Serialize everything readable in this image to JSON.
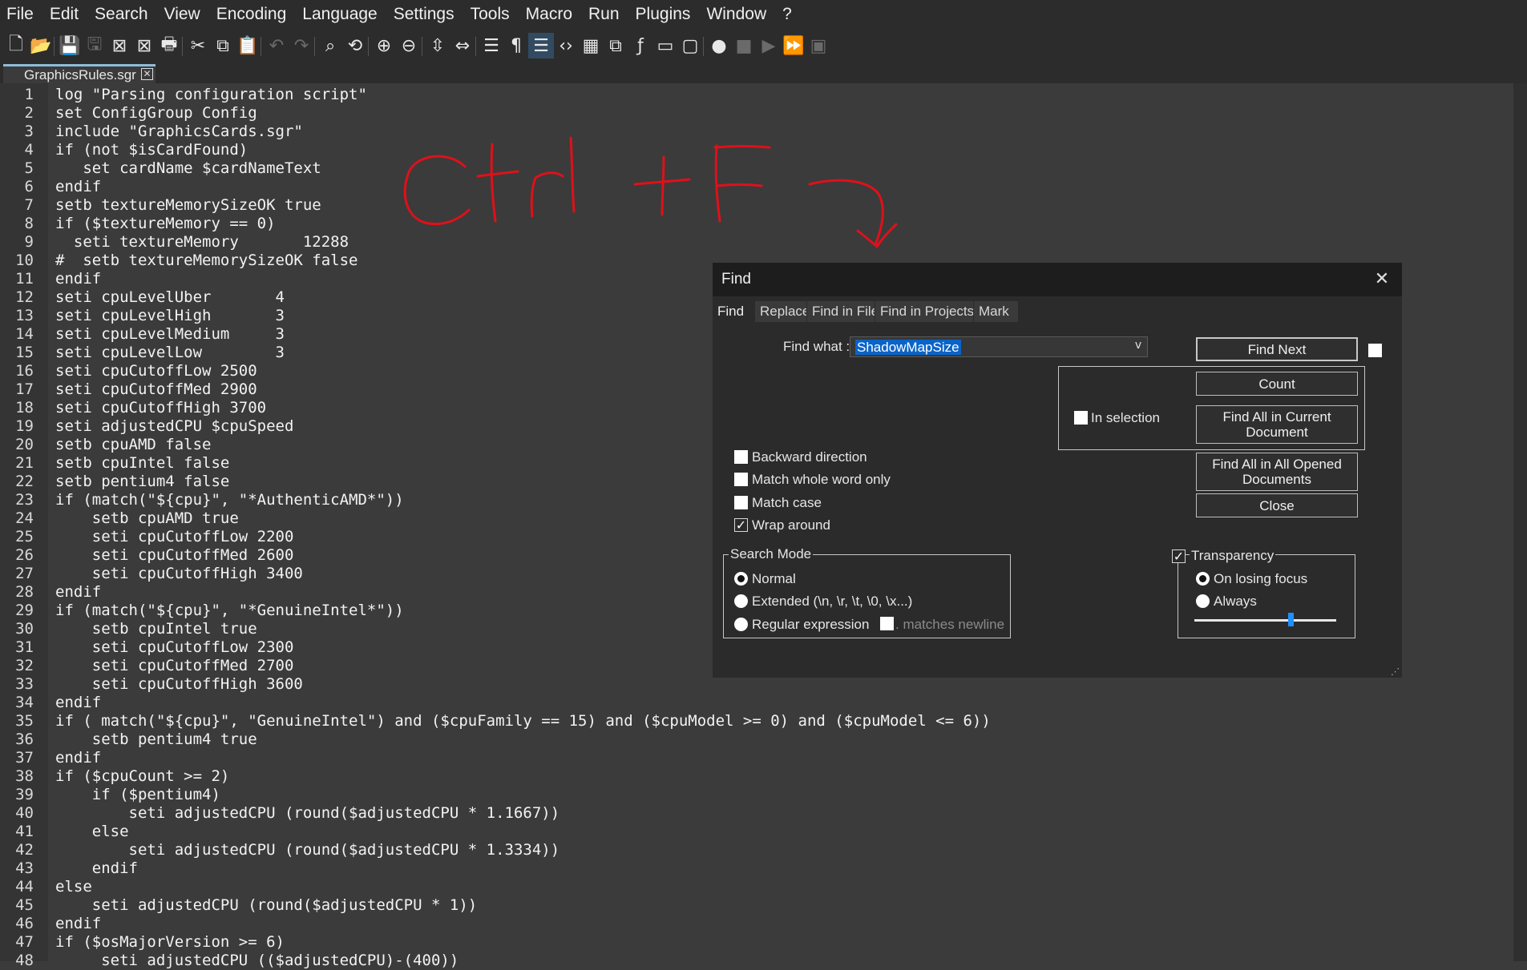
{
  "menu": [
    "File",
    "Edit",
    "Search",
    "View",
    "Encoding",
    "Language",
    "Settings",
    "Tools",
    "Macro",
    "Run",
    "Plugins",
    "Window",
    "?"
  ],
  "tab": {
    "filename": "GraphicsRules.sgr",
    "close_glyph": "✕"
  },
  "toolbar_icons": [
    "new-file-icon",
    "open-folder-icon",
    "save-icon",
    "save-all-icon",
    "close-icon",
    "close-all-icon",
    "print-icon",
    "cut-icon",
    "copy-icon",
    "paste-icon",
    "undo-icon",
    "redo-icon",
    "find-icon",
    "replace-icon",
    "zoom-in-icon",
    "zoom-out-icon",
    "sync-vertical-icon",
    "sync-horizontal-icon",
    "word-wrap-icon",
    "show-all-chars-icon",
    "indent-guide-icon",
    "xml-tags-icon",
    "document-map-icon",
    "document-list-icon",
    "function-list-icon",
    "monitor-icon",
    "folder-workspace-icon",
    "record-macro-icon",
    "stop-record-icon",
    "play-macro-icon",
    "run-macro-multiple-icon",
    "save-macro-icon"
  ],
  "lines": [
    {
      "n": "1",
      "t": "log \"Parsing configuration script\""
    },
    {
      "n": "2",
      "t": "set ConfigGroup Config"
    },
    {
      "n": "3",
      "t": "include \"GraphicsCards.sgr\""
    },
    {
      "n": "4",
      "t": "if (not $isCardFound)"
    },
    {
      "n": "5",
      "t": "   set cardName $cardNameText"
    },
    {
      "n": "6",
      "t": "endif"
    },
    {
      "n": "7",
      "t": "setb textureMemorySizeOK true"
    },
    {
      "n": "8",
      "t": "if ($textureMemory == 0)"
    },
    {
      "n": "9",
      "t": "  seti textureMemory       12288"
    },
    {
      "n": "10",
      "t": "#  setb textureMemorySizeOK false"
    },
    {
      "n": "11",
      "t": "endif"
    },
    {
      "n": "12",
      "t": "seti cpuLevelUber       4"
    },
    {
      "n": "13",
      "t": "seti cpuLevelHigh       3"
    },
    {
      "n": "14",
      "t": "seti cpuLevelMedium     3"
    },
    {
      "n": "15",
      "t": "seti cpuLevelLow        3"
    },
    {
      "n": "16",
      "t": "seti cpuCutoffLow 2500"
    },
    {
      "n": "17",
      "t": "seti cpuCutoffMed 2900"
    },
    {
      "n": "18",
      "t": "seti cpuCutoffHigh 3700"
    },
    {
      "n": "19",
      "t": "seti adjustedCPU $cpuSpeed"
    },
    {
      "n": "20",
      "t": "setb cpuAMD false"
    },
    {
      "n": "21",
      "t": "setb cpuIntel false"
    },
    {
      "n": "22",
      "t": "setb pentium4 false"
    },
    {
      "n": "23",
      "t": "if (match(\"${cpu}\", \"*AuthenticAMD*\"))"
    },
    {
      "n": "24",
      "t": "    setb cpuAMD true"
    },
    {
      "n": "25",
      "t": "    seti cpuCutoffLow 2200"
    },
    {
      "n": "26",
      "t": "    seti cpuCutoffMed 2600"
    },
    {
      "n": "27",
      "t": "    seti cpuCutoffHigh 3400"
    },
    {
      "n": "28",
      "t": "endif"
    },
    {
      "n": "29",
      "t": "if (match(\"${cpu}\", \"*GenuineIntel*\"))"
    },
    {
      "n": "30",
      "t": "    setb cpuIntel true"
    },
    {
      "n": "31",
      "t": "    seti cpuCutoffLow 2300"
    },
    {
      "n": "32",
      "t": "    seti cpuCutoffMed 2700"
    },
    {
      "n": "33",
      "t": "    seti cpuCutoffHigh 3600"
    },
    {
      "n": "34",
      "t": "endif"
    },
    {
      "n": "35",
      "t": "if ( match(\"${cpu}\", \"GenuineIntel\") and ($cpuFamily == 15) and ($cpuModel >= 0) and ($cpuModel <= 6))"
    },
    {
      "n": "36",
      "t": "    setb pentium4 true"
    },
    {
      "n": "37",
      "t": "endif"
    },
    {
      "n": "38",
      "t": "if ($cpuCount >= 2)"
    },
    {
      "n": "39",
      "t": "    if ($pentium4)"
    },
    {
      "n": "40",
      "t": "        seti adjustedCPU (round($adjustedCPU * 1.1667))"
    },
    {
      "n": "41",
      "t": "    else"
    },
    {
      "n": "42",
      "t": "        seti adjustedCPU (round($adjustedCPU * 1.3334))"
    },
    {
      "n": "43",
      "t": "    endif"
    },
    {
      "n": "44",
      "t": "else"
    },
    {
      "n": "45",
      "t": "    seti adjustedCPU (round($adjustedCPU * 1))"
    },
    {
      "n": "46",
      "t": "endif"
    },
    {
      "n": "47",
      "t": "if ($osMajorVersion >= 6)"
    },
    {
      "n": "48",
      "t": "     seti adjustedCPU (($adjustedCPU)-(400))"
    }
  ],
  "find": {
    "title": "Find",
    "close_glyph": "✕",
    "tabs": [
      "Find",
      "Replace",
      "Find in Files",
      "Find in Projects",
      "Mark"
    ],
    "find_what_label": "Find what :",
    "find_what_value": "ShadowMapSize",
    "combo_arrow": "v",
    "buttons": {
      "find_next": "Find Next",
      "count": "Count",
      "find_all_current": "Find All in Current Document",
      "find_all_opened": "Find All in All Opened Documents",
      "close": "Close"
    },
    "in_selection": "In selection",
    "options": {
      "backward": "Backward direction",
      "whole_word": "Match whole word only",
      "match_case": "Match case",
      "wrap_around": "Wrap around"
    },
    "search_mode": {
      "title": "Search Mode",
      "normal": "Normal",
      "extended": "Extended (\\n, \\r, \\t, \\0, \\x...)",
      "regex": "Regular expression",
      "matches_newline": ". matches newline",
      "selected": "normal"
    },
    "transparency": {
      "title": "Transparency",
      "on_losing_focus": "On losing focus",
      "always": "Always",
      "checked": true,
      "selected": "on_losing_focus",
      "level": 0.68
    }
  },
  "colors": {
    "annotation": "#e0101a",
    "accent": "#1e90ff",
    "selection": "#0a64c8"
  }
}
